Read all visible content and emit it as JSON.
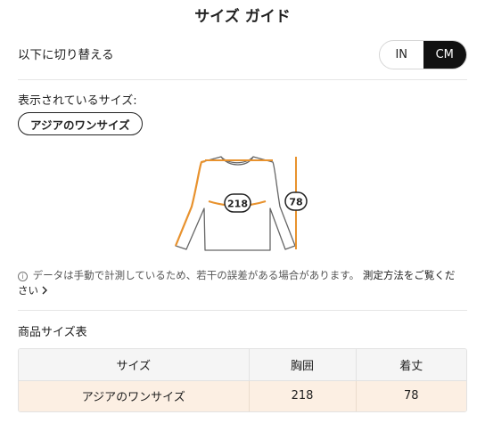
{
  "header": {
    "title": "サイズ ガイド"
  },
  "unit_toggle": {
    "label": "以下に切り替える",
    "options": [
      "IN",
      "CM"
    ],
    "selected": "CM"
  },
  "displayed_size": {
    "label": "表示されているサイズ:",
    "value": "アジアのワンサイズ"
  },
  "diagram": {
    "chest_value": "218",
    "length_value": "78",
    "highlight_color": "#e8922e"
  },
  "note": {
    "text": "データは手動で計測しているため、若干の誤差がある場合があります。",
    "link_part1": "測定方法をご覧くだ",
    "link_part2": "さい"
  },
  "size_table": {
    "title": "商品サイズ表",
    "headers": [
      "サイズ",
      "胸囲",
      "着丈"
    ],
    "rows": [
      [
        "アジアのワンサイズ",
        "218",
        "78"
      ]
    ]
  }
}
